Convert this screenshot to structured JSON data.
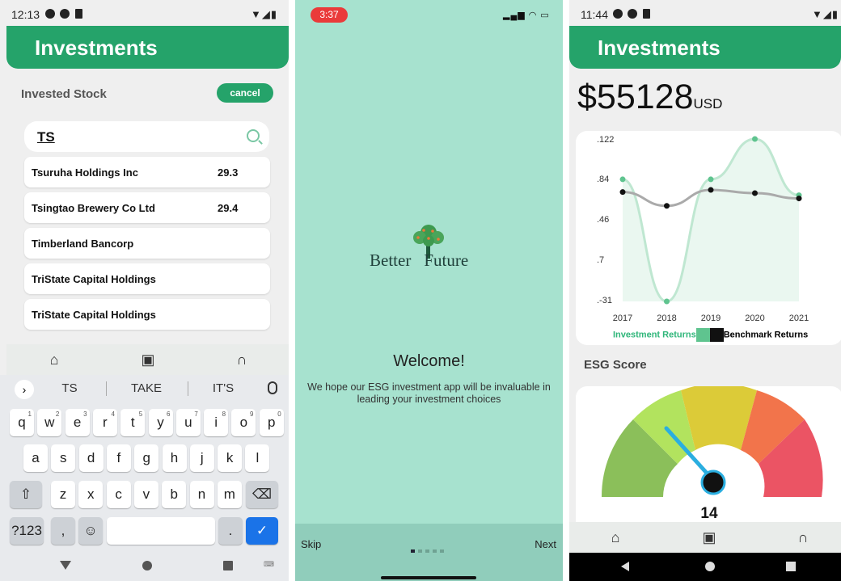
{
  "screen1": {
    "status_time": "12:13",
    "title": "Investments",
    "section_title": "Invested Stock",
    "cancel_label": "cancel",
    "search_value": "TS",
    "stocks": [
      {
        "name": "Tsuruha Holdings Inc",
        "price": "29.3"
      },
      {
        "name": "Tsingtao Brewery Co Ltd",
        "price": "29.4"
      },
      {
        "name": "Timberland Bancorp",
        "price": ""
      },
      {
        "name": "TriState Capital Holdings",
        "price": ""
      },
      {
        "name": "TriState Capital Holdings",
        "price": ""
      }
    ],
    "nav_icons": [
      "home-icon",
      "portfolio-icon",
      "support-icon"
    ],
    "keyboard": {
      "suggestions": [
        "TS",
        "TAKE",
        "IT'S"
      ],
      "row1": [
        "q",
        "w",
        "e",
        "r",
        "t",
        "y",
        "u",
        "i",
        "o",
        "p"
      ],
      "row1_hints": [
        "1",
        "2",
        "3",
        "4",
        "5",
        "6",
        "7",
        "8",
        "9",
        "0"
      ],
      "row2": [
        "a",
        "s",
        "d",
        "f",
        "g",
        "h",
        "j",
        "k",
        "l"
      ],
      "row3": [
        "z",
        "x",
        "c",
        "v",
        "b",
        "n",
        "m"
      ],
      "symbols_label": "?123",
      "comma": ",",
      "period": "."
    }
  },
  "screen2": {
    "status_time": "3:37",
    "logo_word1": "Better",
    "logo_word2": "Future",
    "welcome": "Welcome!",
    "description": "We hope our ESG investment app will be invaluable in leading your investment choices",
    "skip": "Skip",
    "next": "Next",
    "page_index": 1,
    "page_count": 5
  },
  "screen3": {
    "status_time": "11:44",
    "title": "Investments",
    "amount": "$55128",
    "currency": "USD",
    "legend_investment": "Investment Returns",
    "legend_benchmark": "Benchmark Returns",
    "esg_title": "ESG Score",
    "esg_score": "14",
    "colors": {
      "primary": "#25a36a",
      "investment": "#5fc48f",
      "benchmark": "#111111",
      "gauge": [
        "#8bbf5a",
        "#b2e35e",
        "#dccb38",
        "#f2744b",
        "#eb5464"
      ],
      "needle": "#2aaee0"
    }
  },
  "chart_data": {
    "type": "line",
    "x": [
      "2017",
      "2018",
      "2019",
      "2020",
      "2021"
    ],
    "y_tick_labels": [
      ".122",
      ".84",
      ".46",
      ".7",
      ".-31"
    ],
    "series": [
      {
        "name": "Investment Returns",
        "values": [
          0.84,
          -0.31,
          0.84,
          1.22,
          0.69
        ]
      },
      {
        "name": "Benchmark Returns",
        "values": [
          0.72,
          0.59,
          0.74,
          0.71,
          0.66
        ]
      }
    ],
    "xlabel": "",
    "ylabel": "",
    "legend": "bottom"
  }
}
